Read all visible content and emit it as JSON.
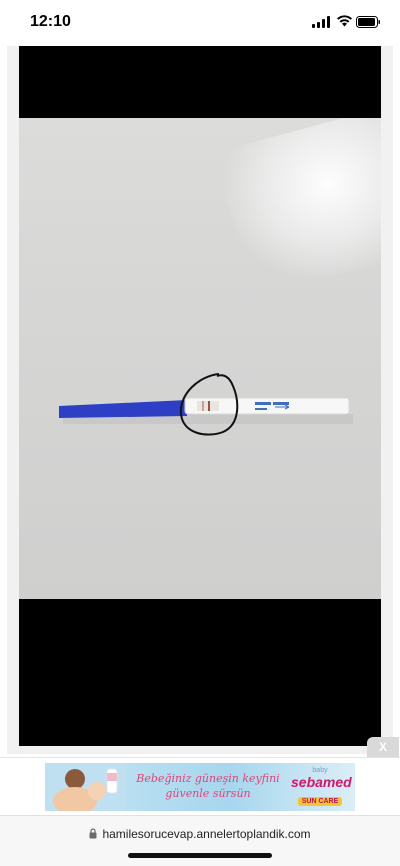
{
  "status_bar": {
    "time": "12:10",
    "icons": [
      "cellular-signal-icon",
      "wifi-icon",
      "battery-icon"
    ]
  },
  "viewer": {
    "image_icon": "photo",
    "annotation_icon": "circle-annotation"
  },
  "ad": {
    "close_label": "X",
    "tagline_line1": "Bebeğiniz güneşin keyfini",
    "tagline_line2": "güvenle sürsün",
    "brand_prefix": "baby",
    "brand_name": "sebamed",
    "brand_sub": "SUN CARE"
  },
  "browser": {
    "url": "hamilesorucevap.annelertoplandik.com",
    "lock_icon": "lock-icon"
  },
  "colors": {
    "test_strip_handle": "#2d3fc4",
    "ad_text": "#e0447a",
    "brand": "#d6156c"
  }
}
